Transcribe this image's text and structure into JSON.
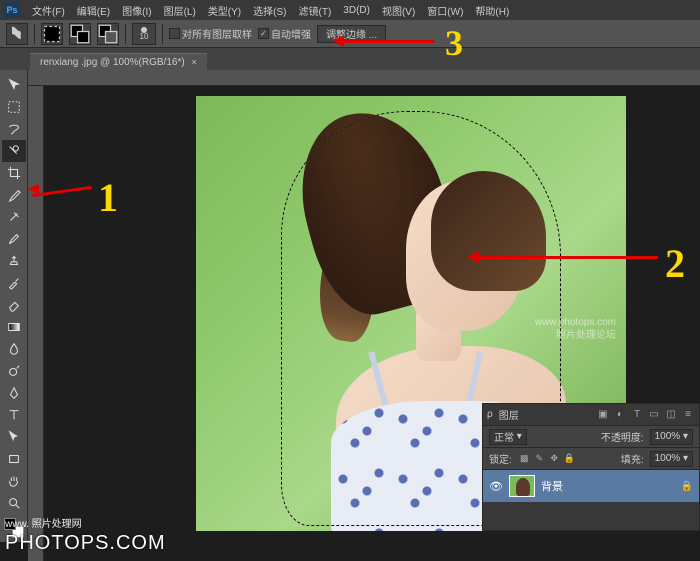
{
  "app": {
    "logo": "Ps"
  },
  "menu": {
    "items": [
      "文件(F)",
      "编辑(E)",
      "图像(I)",
      "图层(L)",
      "类型(Y)",
      "选择(S)",
      "滤镜(T)",
      "3D(D)",
      "视图(V)",
      "窗口(W)",
      "帮助(H)"
    ]
  },
  "options": {
    "brush_size": "10",
    "sample_all_label": "对所有图层取样",
    "sample_all_checked": false,
    "auto_enhance_label": "自动增强",
    "auto_enhance_checked": true,
    "refine_edge_label": "调整边缘 ..."
  },
  "tab": {
    "filename": "renxiang .jpg @ 100%(RGB/16*)",
    "close": "×"
  },
  "canvas_watermark": {
    "line1": "www.photops.com",
    "line2": "照片处理论坛"
  },
  "panel": {
    "tab_label": "图层",
    "kind_icon": "ρ",
    "blend_mode": "正常",
    "opacity_label": "不透明度:",
    "opacity_value": "100%",
    "lock_label": "锁定:",
    "fill_label": "填充:",
    "fill_value": "100%",
    "layer": {
      "name": "背景",
      "locked": true
    }
  },
  "annotations": {
    "n1": "1",
    "n2": "2",
    "n3": "3"
  },
  "watermark": {
    "small": "www. 照片处理网",
    "big": "PHOTOPS.COM"
  }
}
